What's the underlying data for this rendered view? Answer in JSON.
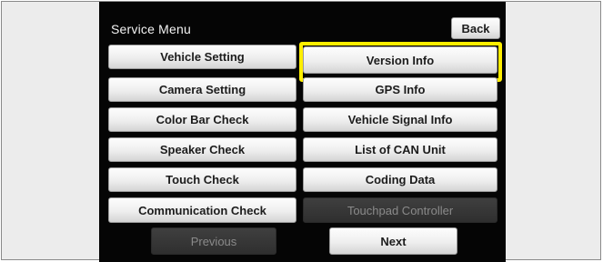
{
  "screen": {
    "title": "Service Menu",
    "back_label": "Back"
  },
  "left_column": [
    {
      "label": "Vehicle Setting"
    },
    {
      "label": "Camera Setting"
    },
    {
      "label": "Color Bar Check"
    },
    {
      "label": "Speaker Check"
    },
    {
      "label": "Touch Check"
    },
    {
      "label": "Communication Check"
    }
  ],
  "right_column": [
    {
      "label": "Version Info",
      "highlighted": true
    },
    {
      "label": "GPS Info"
    },
    {
      "label": "Vehicle Signal Info"
    },
    {
      "label": "List of CAN Unit"
    },
    {
      "label": "Coding Data"
    },
    {
      "label": "Touchpad Controller",
      "disabled": true
    }
  ],
  "pager": {
    "previous_label": "Previous",
    "previous_disabled": true,
    "next_label": "Next"
  },
  "colors": {
    "highlight": "#ffee00",
    "screen_background": "#050505"
  }
}
